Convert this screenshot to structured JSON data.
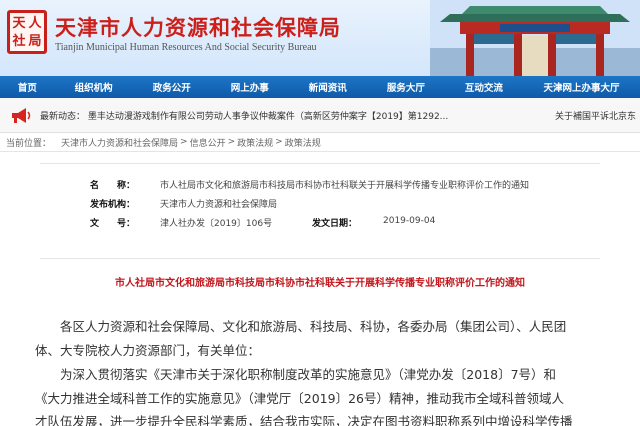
{
  "header": {
    "seal_chars": [
      "天",
      "人",
      "社",
      "局"
    ],
    "title_zh": "天津市人力资源和社会保障局",
    "title_en": "Tianjin Municipal Human Resources And Social Security Bureau"
  },
  "nav": {
    "items": [
      "首页",
      "组织机构",
      "政务公开",
      "网上办事",
      "新闻资讯",
      "服务大厅",
      "互动交流",
      "天津网上办事大厅"
    ]
  },
  "notice": {
    "icon": "megaphone-icon",
    "text": "最新动态：  墨丰达动漫游戏制作有限公司劳动人事争议仲裁案件（高新区劳仲案字【2019】第1292...",
    "right_text": "关于補国平诉北京东"
  },
  "breadcrumb": {
    "label": "当前位置：",
    "items": [
      "天津市人力资源和社会保障局",
      "信息公开",
      "政策法规",
      "政策法规"
    ],
    "separator": ">"
  },
  "meta": {
    "name_label": "名　　称：",
    "name_value": "市人社局市文化和旅游局市科技局市科协市社科联关于开展科学传播专业职称评价工作的通知",
    "issuer_label": "发布机构：",
    "issuer_value": "天津市人力资源和社会保障局",
    "docno_label": "文　　号：",
    "docno_value": "津人社办发〔2019〕106号",
    "date_label": "发文日期：",
    "date_value": "2019-09-04"
  },
  "document": {
    "title": "市人社局市文化和旅游局市科技局市科协市社科联关于开展科学传播专业职称评价工作的通知",
    "lines": [
      "各区人力资源和社会保障局、文化和旅游局、科技局、科协，各委办局（集团公司）、人民团",
      "体、大专院校人力资源部门，有关单位：",
      "为深入贯彻落实《天津市关于深化职称制度改革的实施意见》（津党办发〔2018〕7号）和",
      "《大力推进全域科普工作的实施意见》（津党厅〔2019〕26号）精神，推动我市全域科普领域人",
      "才队伍发展，进一步提升全民科学素质，结合我市实际，决定在图书资料职称系列中增设科学传播"
    ]
  },
  "colors": {
    "brand_red": "#cc1f1a",
    "nav_blue": "#1466b4",
    "doc_title_red": "#c4161c"
  }
}
